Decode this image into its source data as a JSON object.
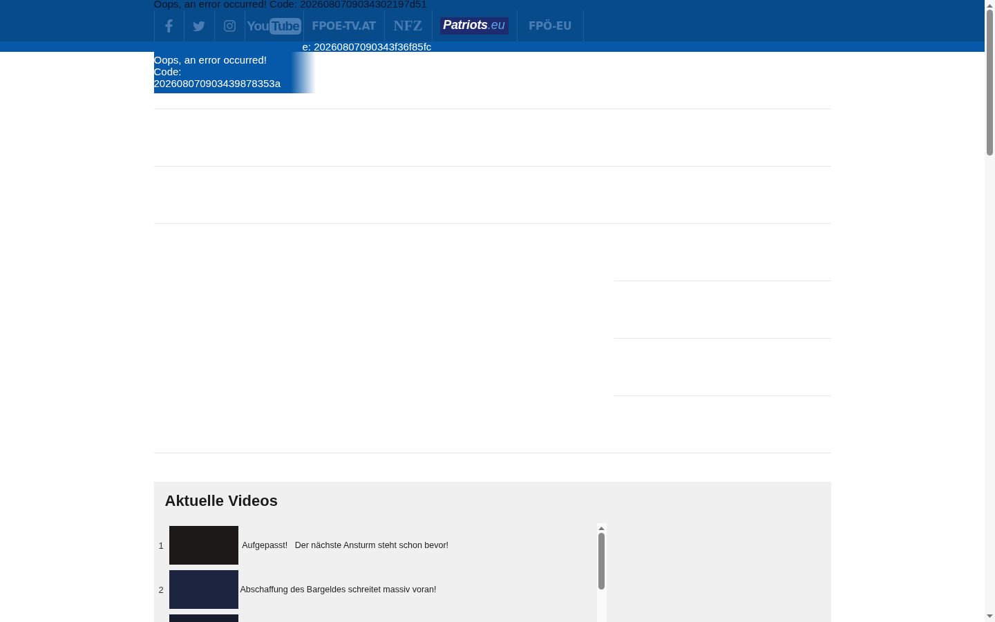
{
  "header": {
    "error_text": "Oops, an error occurred! Code: 2026080709034302197d51"
  },
  "nav": [
    {
      "kind": "facebook"
    },
    {
      "kind": "twitter"
    },
    {
      "kind": "instagram"
    },
    {
      "kind": "youtube",
      "label": "You",
      "badge": "Tube"
    },
    {
      "kind": "wordmark",
      "label": "FPOE-TV.AT"
    },
    {
      "kind": "serif",
      "label": "NFZ"
    },
    {
      "kind": "patriots",
      "label": "Patriots",
      "suffix": ".eu"
    },
    {
      "kind": "wordmark",
      "label": "FPÖ-EU"
    }
  ],
  "strip": {
    "error_text": "e: 20260807090343f36f85fc"
  },
  "error_box": {
    "text": "Oops, an error occurred! Code: 202608070903439878353a"
  },
  "videos": {
    "title": "Aktuelle Videos",
    "items": [
      {
        "number": "1",
        "title": " Aufgepasst!   Der nächste Ansturm steht schon bevor!"
      },
      {
        "number": "2",
        "title": "Abschaffung des Bargeldes schreitet massiv voran!"
      }
    ],
    "partial_next_item": true
  }
}
